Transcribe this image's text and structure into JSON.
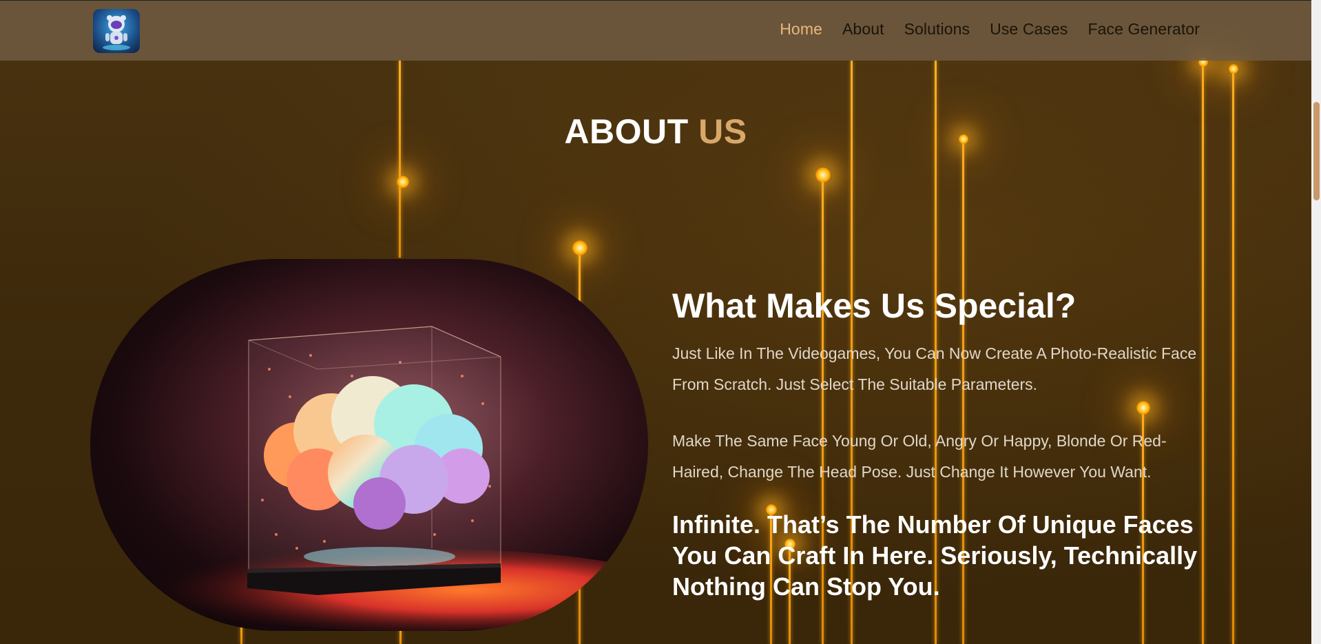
{
  "nav": {
    "items": [
      {
        "label": "Home",
        "active": true
      },
      {
        "label": "About",
        "active": false
      },
      {
        "label": "Solutions",
        "active": false
      },
      {
        "label": "Use Cases",
        "active": false
      },
      {
        "label": "Face Generator",
        "active": false
      }
    ]
  },
  "about": {
    "title_main": "ABOUT",
    "title_accent": "US",
    "heading": "What Makes Us Special?",
    "paragraph1": "Just Like In The Videogames, You Can Now Create A Photo-Realistic Face From Scratch. Just Select The Suitable Parameters.",
    "paragraph2": "Make The Same Face Young Or Old, Angry Or Happy, Blonde Or Red-Haired, Change The Head Pose. Just Change It However You Want.",
    "tagline": "Infinite. That’s The Number Of Unique Faces You Can Craft In Here. Seriously, Technically Nothing Can Stop You."
  },
  "colors": {
    "accent": "#d8a86a",
    "nav_active": "#e9b878",
    "background": "#3e2a0c",
    "navbar": "#6e5a41",
    "glow": "#ffb01f"
  },
  "icons": {
    "logo": "robot-mascot-logo",
    "hero": "glowing-cloud-in-glass-cube"
  }
}
